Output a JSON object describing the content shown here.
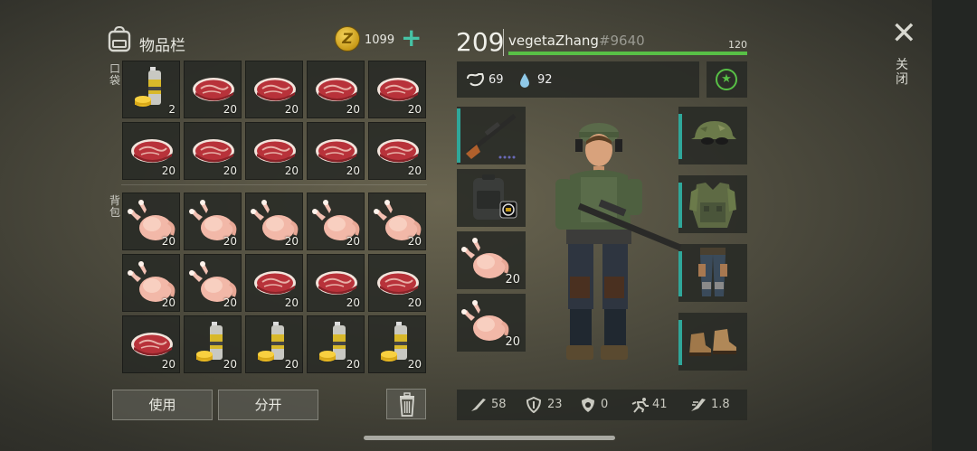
{
  "inventory": {
    "title": "物品栏",
    "gold": "1099",
    "gold_add": "+",
    "coin_letter": "Z",
    "pocket_label": "口袋",
    "backpack_label": "背包"
  },
  "pocket_items": [
    {
      "type": "paint",
      "count": "2"
    },
    {
      "type": "steak",
      "count": "20"
    },
    {
      "type": "steak",
      "count": "20"
    },
    {
      "type": "steak",
      "count": "20"
    },
    {
      "type": "steak",
      "count": "20"
    },
    {
      "type": "steak",
      "count": "20"
    },
    {
      "type": "steak",
      "count": "20"
    },
    {
      "type": "steak",
      "count": "20"
    },
    {
      "type": "steak",
      "count": "20"
    },
    {
      "type": "steak",
      "count": "20"
    }
  ],
  "backpack_items": [
    {
      "type": "chicken",
      "count": "20"
    },
    {
      "type": "chicken",
      "count": "20"
    },
    {
      "type": "chicken",
      "count": "20"
    },
    {
      "type": "chicken",
      "count": "20"
    },
    {
      "type": "chicken",
      "count": "20"
    },
    {
      "type": "chicken",
      "count": "20"
    },
    {
      "type": "chicken",
      "count": "20"
    },
    {
      "type": "steak",
      "count": "20"
    },
    {
      "type": "steak",
      "count": "20"
    },
    {
      "type": "steak",
      "count": "20"
    },
    {
      "type": "steak",
      "count": "20"
    },
    {
      "type": "paint",
      "count": "20"
    },
    {
      "type": "paint",
      "count": "20"
    },
    {
      "type": "paint",
      "count": "20"
    },
    {
      "type": "paint",
      "count": "20"
    }
  ],
  "actions": {
    "use": "使用",
    "split": "分开"
  },
  "player": {
    "level": "209",
    "name": "vegetaZhang",
    "tag": "#9640",
    "hp": "120",
    "hp_fraction": 1.0,
    "food": "69",
    "water": "92"
  },
  "equip_left": [
    {
      "type": "rifle",
      "count": ""
    },
    {
      "type": "backpack",
      "count": ""
    },
    {
      "type": "chicken",
      "count": "20"
    },
    {
      "type": "chicken",
      "count": "20"
    }
  ],
  "armor": [
    {
      "type": "helmet"
    },
    {
      "type": "vest"
    },
    {
      "type": "pants"
    },
    {
      "type": "boots"
    }
  ],
  "stats": {
    "attack": "58",
    "defense": "23",
    "radiation": "0",
    "speed": "41",
    "stealth": "1.8"
  },
  "close": {
    "icon": "close-icon",
    "label": "关闭"
  },
  "colors": {
    "accent": "#2fa79a",
    "hp": "#58c046",
    "plus": "#46c3a6"
  }
}
